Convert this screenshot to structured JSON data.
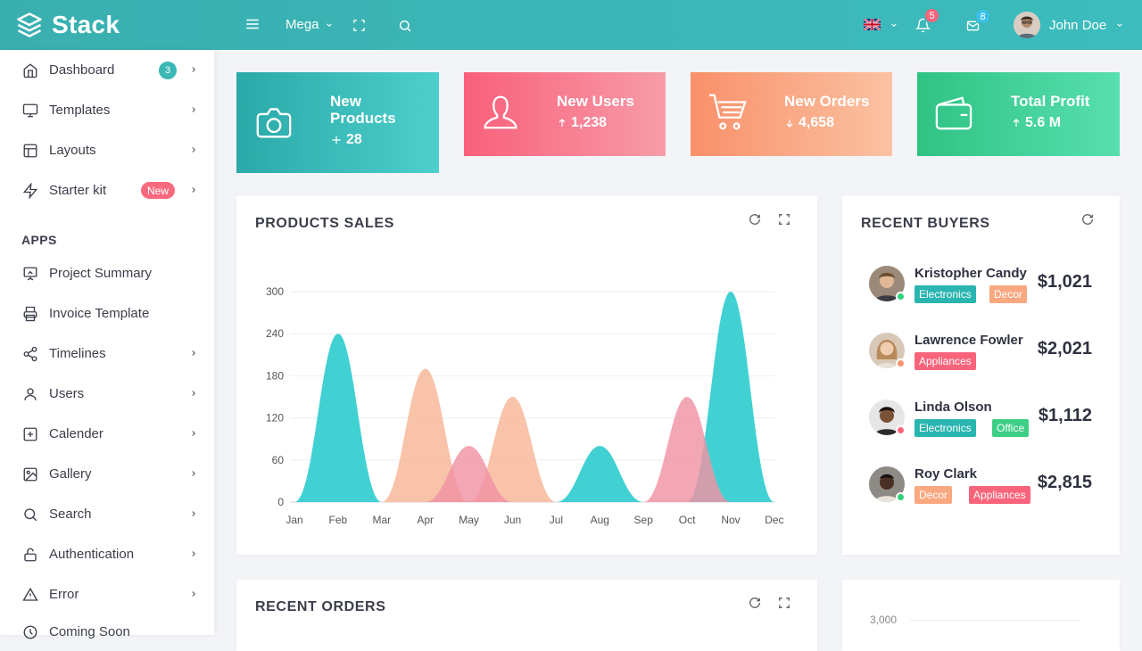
{
  "brand": {
    "name": "Stack"
  },
  "topbar": {
    "mega_label": "Mega",
    "notifications_count": "5",
    "messages_count": "8",
    "user_name": "John Doe"
  },
  "sidebar": {
    "items": [
      {
        "label": "Dashboard",
        "icon": "home-icon",
        "count": "3"
      },
      {
        "label": "Templates",
        "icon": "monitor-icon"
      },
      {
        "label": "Layouts",
        "icon": "layout-icon"
      },
      {
        "label": "Starter kit",
        "icon": "zap-icon",
        "badge": "New"
      }
    ],
    "section_label": "APPS",
    "apps": [
      {
        "label": "Project Summary",
        "icon": "presentation-icon"
      },
      {
        "label": "Invoice Template",
        "icon": "printer-icon"
      },
      {
        "label": "Timelines",
        "icon": "share-icon"
      },
      {
        "label": "Users",
        "icon": "user-icon"
      },
      {
        "label": "Calender",
        "icon": "plus-square-icon"
      },
      {
        "label": "Gallery",
        "icon": "image-icon"
      },
      {
        "label": "Search",
        "icon": "search-icon"
      },
      {
        "label": "Authentication",
        "icon": "unlock-icon"
      },
      {
        "label": "Error",
        "icon": "alert-triangle-icon"
      },
      {
        "label": "Coming Soon",
        "icon": "clock-icon"
      }
    ]
  },
  "stats": [
    {
      "title": "New Products",
      "value": "28",
      "icon": "camera-icon",
      "trend": "plus",
      "colors": [
        "#2aa9a8",
        "#4dcfcc"
      ]
    },
    {
      "title": "New Users",
      "value": "1,238",
      "icon": "user-icon",
      "trend": "up",
      "colors": [
        "#f9607a",
        "#f79ca8"
      ]
    },
    {
      "title": "New Orders",
      "value": "4,658",
      "icon": "cart-icon",
      "trend": "down",
      "colors": [
        "#f9906a",
        "#fbc2a2"
      ]
    },
    {
      "title": "Total Profit",
      "value": "5.6 M",
      "icon": "wallet-icon",
      "trend": "up",
      "colors": [
        "#2fc383",
        "#58dfb0"
      ]
    }
  ],
  "products_sales": {
    "title": "PRODUCTS SALES"
  },
  "chart_data": {
    "type": "area",
    "title": "PRODUCTS SALES",
    "categories": [
      "Jan",
      "Feb",
      "Mar",
      "Apr",
      "May",
      "Jun",
      "Jul",
      "Aug",
      "Sep",
      "Oct",
      "Nov",
      "Dec"
    ],
    "yticks": [
      0,
      60,
      120,
      180,
      240,
      300
    ],
    "ylim": [
      0,
      300
    ],
    "series": [
      {
        "color": "#37cfd1",
        "values": [
          0,
          240,
          0,
          0,
          0,
          0,
          0,
          80,
          0,
          0,
          300,
          0
        ]
      },
      {
        "color": "#f6b696",
        "values": [
          0,
          0,
          0,
          190,
          0,
          150,
          0,
          0,
          0,
          0,
          0,
          0
        ]
      },
      {
        "color": "#f092a3",
        "values": [
          0,
          0,
          0,
          0,
          80,
          0,
          0,
          0,
          0,
          150,
          0,
          0
        ]
      }
    ],
    "grid": true,
    "legend": "none"
  },
  "recent_buyers": {
    "title": "RECENT BUYERS",
    "buyers": [
      {
        "name": "Kristopher Candy",
        "amount": "$1,021",
        "status_color": "#2fd07a",
        "tags": [
          {
            "label": "Electronics",
            "color": "#2ab5b0"
          },
          {
            "label": "Decor",
            "color": "#f9a880"
          }
        ]
      },
      {
        "name": "Lawrence Fowler",
        "amount": "$2,021",
        "status_color": "#f9946a",
        "tags": [
          {
            "label": "Appliances",
            "color": "#f9647b"
          }
        ]
      },
      {
        "name": "Linda Olson",
        "amount": "$1,112",
        "status_color": "#f9647b",
        "tags": [
          {
            "label": "Electronics",
            "color": "#2ab5b0"
          },
          {
            "label": "Office",
            "color": "#3dcf85"
          }
        ]
      },
      {
        "name": "Roy Clark",
        "amount": "$2,815",
        "status_color": "#2fd07a",
        "tags": [
          {
            "label": "Decor",
            "color": "#f9a880"
          },
          {
            "label": "Appliances",
            "color": "#f9647b"
          }
        ]
      }
    ]
  },
  "recent_orders": {
    "title": "RECENT ORDERS"
  },
  "bottom_chart": {
    "tick": "3,000"
  }
}
